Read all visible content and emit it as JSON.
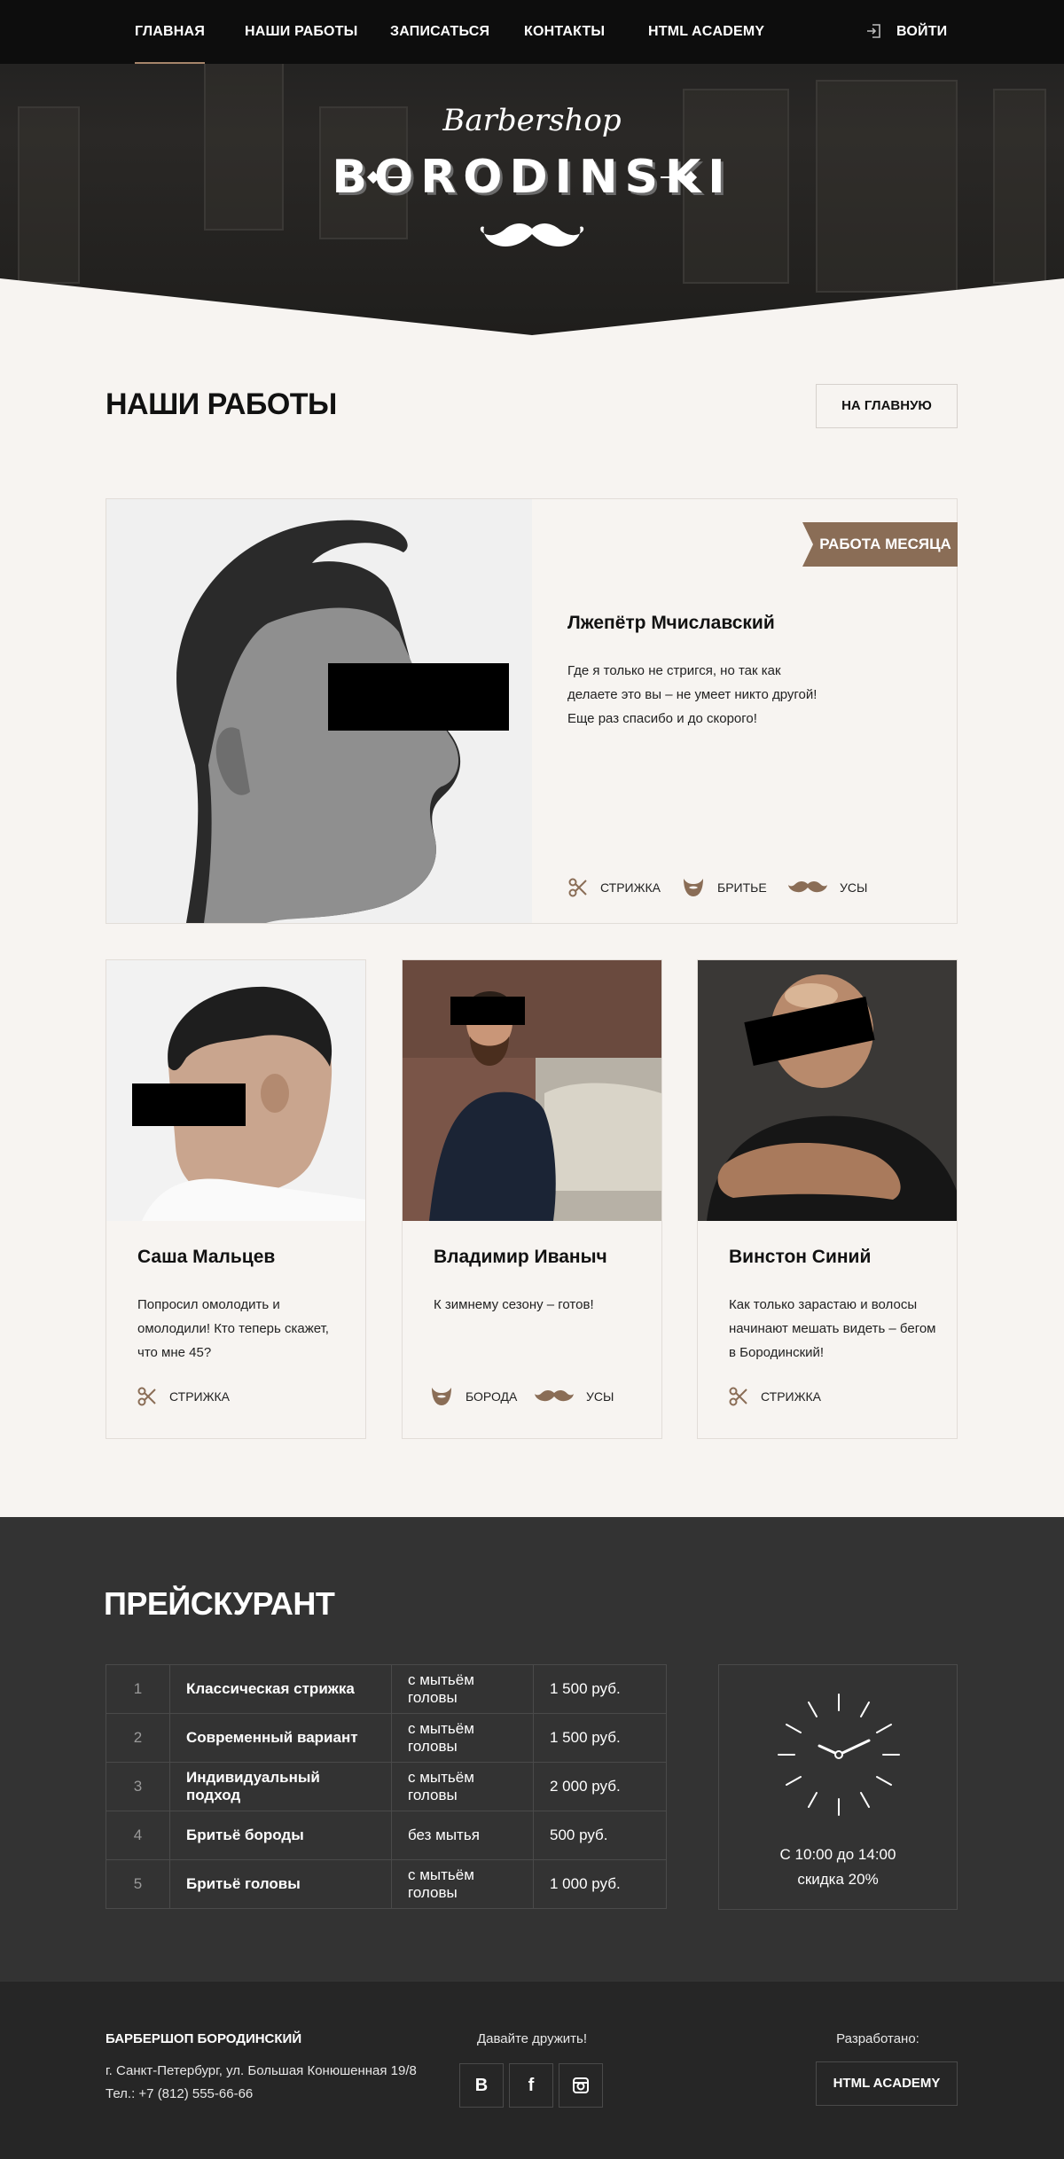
{
  "nav": {
    "items": [
      {
        "label": "ГЛАВНАЯ",
        "active": true
      },
      {
        "label": "НАШИ РАБОТЫ",
        "active": false
      },
      {
        "label": "ЗАПИСАТЬСЯ",
        "active": false
      },
      {
        "label": "КОНТАКТЫ",
        "active": false
      },
      {
        "label": "HTML ACADEMY",
        "active": false
      }
    ],
    "login_label": "ВОЙТИ",
    "login_icon": "login-icon"
  },
  "logo": {
    "script": "Barbershop",
    "main": "BORODINSKI",
    "icon": "mustache-icon"
  },
  "page": {
    "title": "НАШИ РАБОТЫ",
    "home_button": "НА ГЛАВНУЮ"
  },
  "featured": {
    "badge": "РАБОТА МЕСЯЦА",
    "name": "Лжепётр Мчиславский",
    "text": "Где я только не стригся, но так как делаете это вы – не умеет никто другой! Еще раз спасибо и до скорого!",
    "tags": [
      {
        "icon": "scissors-icon",
        "label": "СТРИЖКА"
      },
      {
        "icon": "beard-icon",
        "label": "БРИТЬЕ"
      },
      {
        "icon": "mustache-icon",
        "label": "УСЫ"
      }
    ]
  },
  "works": [
    {
      "name": "Саша Мальцев",
      "text": "Попросил омолодить и омолодили! Кто теперь скажет, что мне 45?",
      "tags": [
        {
          "icon": "scissors-icon",
          "label": "СТРИЖКА"
        }
      ]
    },
    {
      "name": "Владимир Иваныч",
      "text": "К зимнему сезону – готов!",
      "tags": [
        {
          "icon": "beard-icon",
          "label": "БОРОДА"
        },
        {
          "icon": "mustache-icon",
          "label": "УСЫ"
        }
      ]
    },
    {
      "name": "Винстон Синий",
      "text": "Как только зарастаю и волосы начинают мешать видеть – бегом в Бородинский!",
      "tags": [
        {
          "icon": "scissors-icon",
          "label": "СТРИЖКА"
        }
      ]
    }
  ],
  "price": {
    "title": "ПРЕЙСКУРАНТ",
    "rows": [
      {
        "num": "1",
        "name": "Классическая стрижка",
        "option": "с мытьём головы",
        "price": "1 500 руб."
      },
      {
        "num": "2",
        "name": "Современный вариант",
        "option": "с мытьём головы",
        "price": "1 500 руб."
      },
      {
        "num": "3",
        "name": "Индивидуальный подход",
        "option": "с мытьём головы",
        "price": "2 000 руб."
      },
      {
        "num": "4",
        "name": "Бритьё бороды",
        "option": "без мытья",
        "price": "500 руб."
      },
      {
        "num": "5",
        "name": "Бритьё головы",
        "option": "с мытьём головы",
        "price": "1 000 руб."
      }
    ],
    "promo_line1": "С 10:00 до 14:00",
    "promo_line2": "скидка 20%",
    "promo_icon": "clock-icon"
  },
  "footer": {
    "brand": "БАРБЕРШОП БОРОДИНСКИЙ",
    "address": "г. Санкт-Петербург, ул. Большая Конюшенная 19/8",
    "phone": "Тел.: +7 (812) 555-66-66",
    "friends": "Давайте дружить!",
    "social": [
      {
        "icon": "vk-icon",
        "glyph": "B"
      },
      {
        "icon": "facebook-icon",
        "glyph": "f"
      },
      {
        "icon": "instagram-icon",
        "glyph": ""
      }
    ],
    "developed": "Разработано:",
    "academy": "HTML ACADEMY"
  },
  "colors": {
    "accent": "#8a6d56",
    "dark": "#333333",
    "footer": "#262626",
    "background": "#f7f4f1"
  }
}
